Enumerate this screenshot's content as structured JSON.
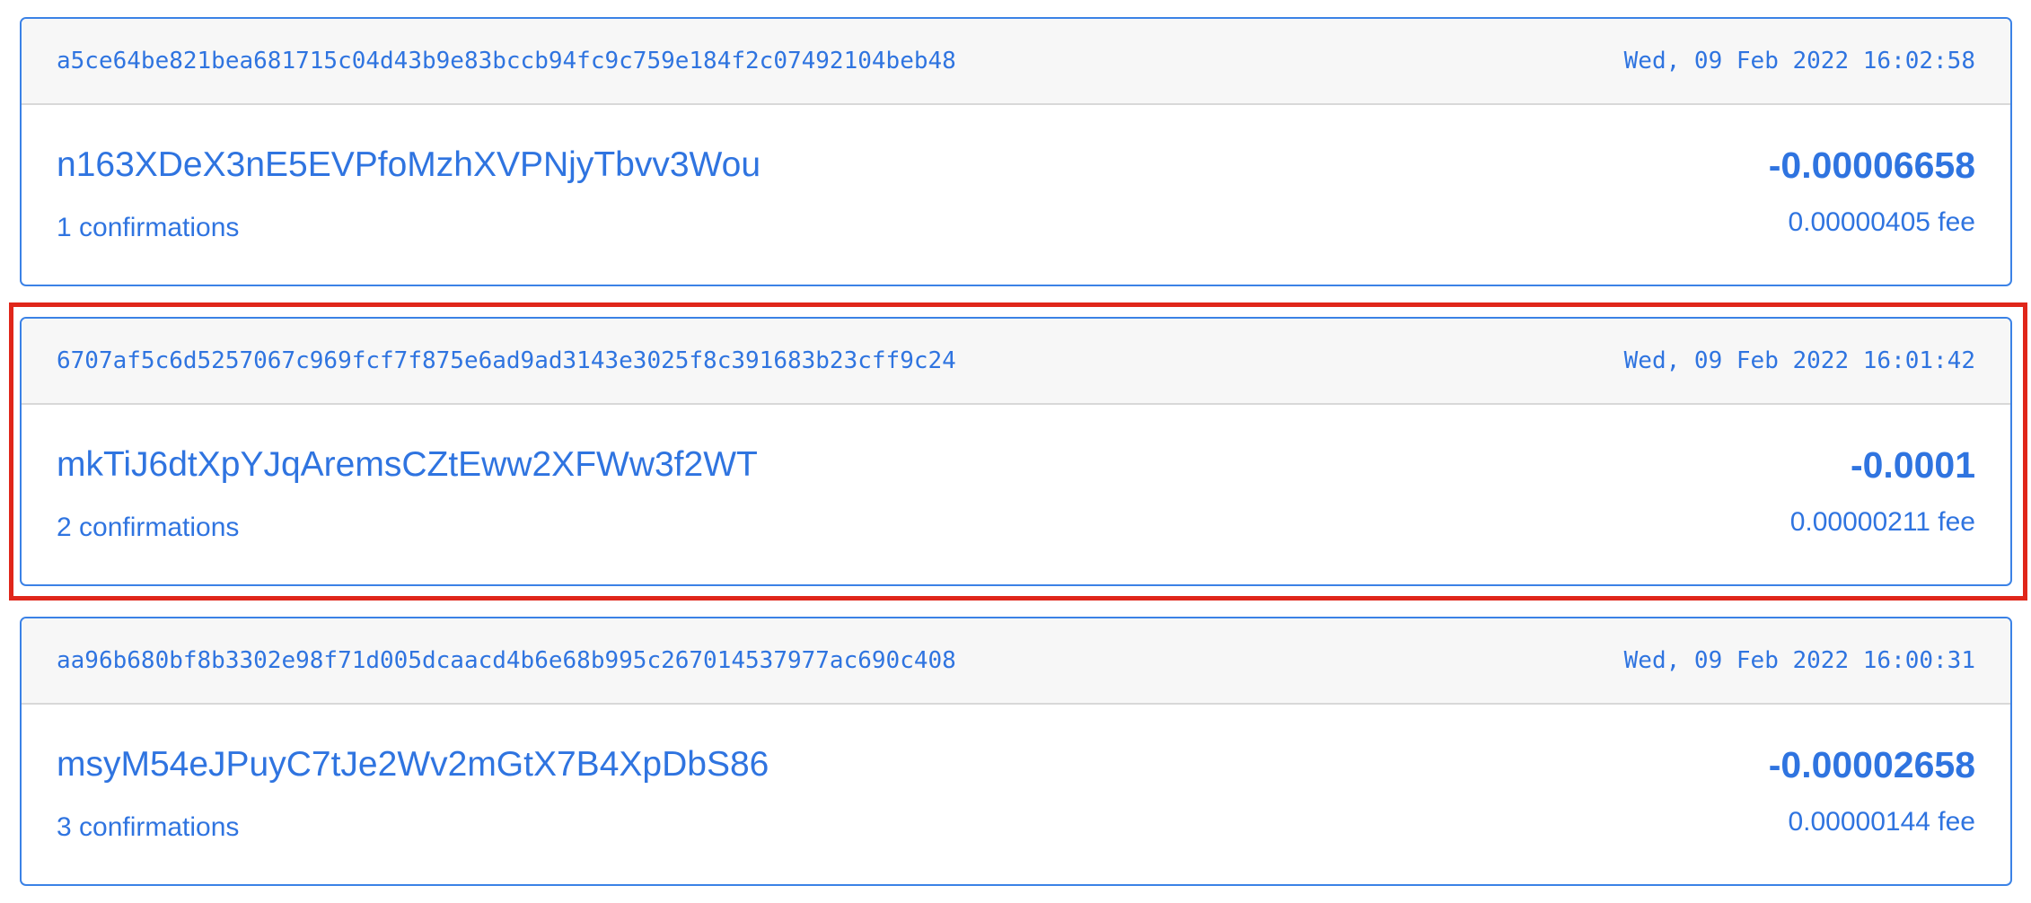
{
  "transactions": [
    {
      "hash": "a5ce64be821bea681715c04d43b9e83bccb94fc9c759e184f2c07492104beb48",
      "time": "Wed, 09 Feb 2022 16:02:58",
      "address": "n163XDeX3nE5EVPfoMzhXVPNjyTbvv3Wou",
      "confirmations": "1 confirmations",
      "amount": "-0.00006658",
      "fee": "0.00000405 fee"
    },
    {
      "hash": "6707af5c6d5257067c969fcf7f875e6ad9ad3143e3025f8c391683b23cff9c24",
      "time": "Wed, 09 Feb 2022 16:01:42",
      "address": "mkTiJ6dtXpYJqAremsCZtEww2XFWw3f2WT",
      "confirmations": "2 confirmations",
      "amount": "-0.0001",
      "fee": "0.00000211 fee"
    },
    {
      "hash": "aa96b680bf8b3302e98f71d005dcaacd4b6e68b995c267014537977ac690c408",
      "time": "Wed, 09 Feb 2022 16:00:31",
      "address": "msyM54eJPuyC7tJe2Wv2mGtX7B4XpDbS86",
      "confirmations": "3 confirmations",
      "amount": "-0.00002658",
      "fee": "0.00000144 fee"
    }
  ],
  "colors": {
    "accent": "#2f74e0",
    "card_border": "#3b82e6",
    "header_bg": "#f7f7f7",
    "highlight": "#e0261a"
  }
}
